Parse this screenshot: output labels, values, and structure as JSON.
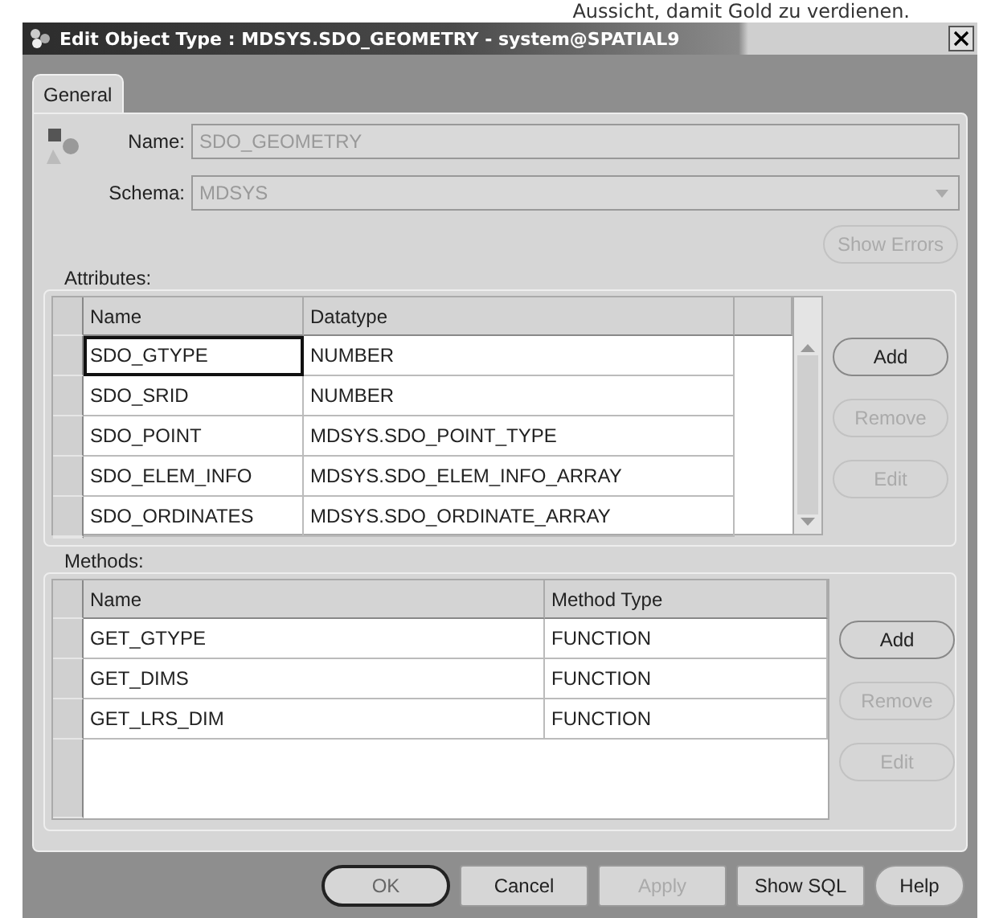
{
  "page_caption": "Aussicht, damit Gold zu verdienen.",
  "window": {
    "title": "Edit Object Type : MDSYS.SDO_GEOMETRY - system@SPATIAL9"
  },
  "tabs": [
    {
      "label": "General",
      "selected": true
    }
  ],
  "fields": [
    {
      "kind": "text",
      "label": "Name:",
      "value": "SDO_GEOMETRY",
      "disabled": true
    },
    {
      "kind": "dropdown",
      "label": "Schema:",
      "value": "MDSYS",
      "disabled": true
    }
  ],
  "show_errors": {
    "label": "Show Errors",
    "disabled": true
  },
  "attributes": {
    "title": "Attributes:",
    "columns": [
      "Name",
      "Datatype"
    ],
    "rows": [
      {
        "cells": [
          "SDO_GTYPE",
          "NUMBER"
        ],
        "selected": true
      },
      {
        "cells": [
          "SDO_SRID",
          "NUMBER"
        ],
        "selected": false
      },
      {
        "cells": [
          "SDO_POINT",
          "MDSYS.SDO_POINT_TYPE"
        ],
        "selected": false
      },
      {
        "cells": [
          "SDO_ELEM_INFO",
          "MDSYS.SDO_ELEM_INFO_ARRAY"
        ],
        "selected": false
      },
      {
        "cells": [
          "SDO_ORDINATES",
          "MDSYS.SDO_ORDINATE_ARRAY"
        ],
        "selected": false
      }
    ],
    "buttons": [
      {
        "label": "Add",
        "disabled": false
      },
      {
        "label": "Remove",
        "disabled": true
      },
      {
        "label": "Edit",
        "disabled": true
      }
    ]
  },
  "methods": {
    "title": "Methods:",
    "columns": [
      "Name",
      "Method Type"
    ],
    "rows": [
      {
        "cells": [
          "GET_GTYPE",
          "FUNCTION"
        ]
      },
      {
        "cells": [
          "GET_DIMS",
          "FUNCTION"
        ]
      },
      {
        "cells": [
          "GET_LRS_DIM",
          "FUNCTION"
        ]
      }
    ],
    "buttons": [
      {
        "label": "Add",
        "disabled": false
      },
      {
        "label": "Remove",
        "disabled": true
      },
      {
        "label": "Edit",
        "disabled": true
      }
    ]
  },
  "footer_buttons": [
    {
      "label": "OK",
      "disabled": false,
      "default": true
    },
    {
      "label": "Cancel",
      "disabled": false,
      "default": false
    },
    {
      "label": "Apply",
      "disabled": true,
      "default": false
    },
    {
      "label": "Show SQL",
      "disabled": false,
      "default": false
    },
    {
      "label": "Help",
      "disabled": false,
      "default": false
    }
  ]
}
